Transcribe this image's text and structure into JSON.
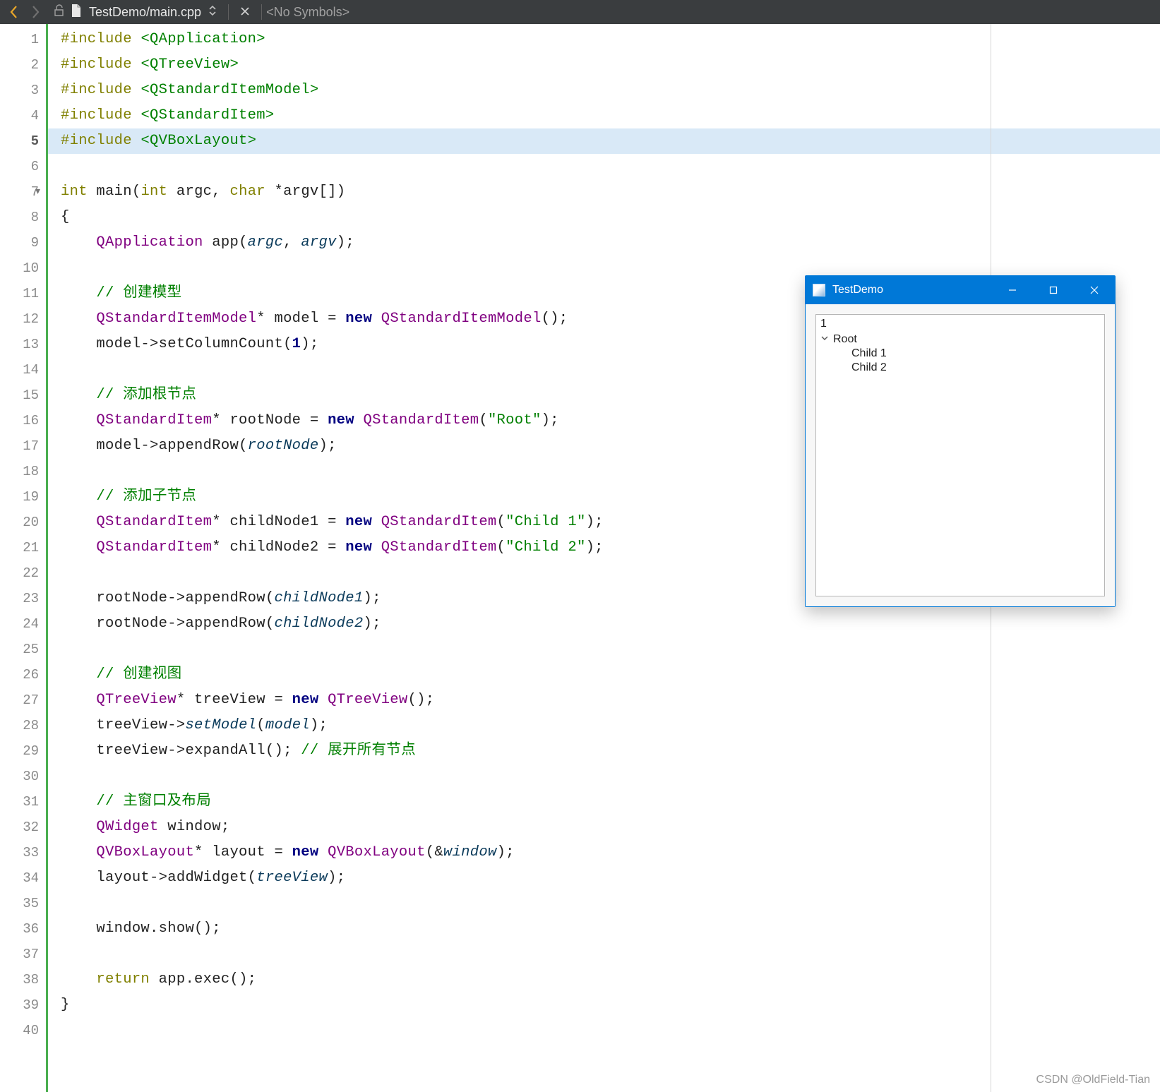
{
  "toolbar": {
    "filepath": "TestDemo/main.cpp",
    "symbols": "<No Symbols>"
  },
  "code": {
    "lines": [
      {
        "n": 1,
        "tokens": [
          {
            "c": "kw-olive",
            "t": "#include"
          },
          {
            "c": "dark",
            "t": " "
          },
          {
            "c": "incpath",
            "t": "<QApplication>"
          }
        ]
      },
      {
        "n": 2,
        "tokens": [
          {
            "c": "kw-olive",
            "t": "#include"
          },
          {
            "c": "dark",
            "t": " "
          },
          {
            "c": "incpath",
            "t": "<QTreeView>"
          }
        ]
      },
      {
        "n": 3,
        "tokens": [
          {
            "c": "kw-olive",
            "t": "#include"
          },
          {
            "c": "dark",
            "t": " "
          },
          {
            "c": "incpath",
            "t": "<QStandardItemModel>"
          }
        ]
      },
      {
        "n": 4,
        "tokens": [
          {
            "c": "kw-olive",
            "t": "#include"
          },
          {
            "c": "dark",
            "t": " "
          },
          {
            "c": "incpath",
            "t": "<QStandardItem>"
          }
        ]
      },
      {
        "n": 5,
        "hl": true,
        "tokens": [
          {
            "c": "kw-olive",
            "t": "#include"
          },
          {
            "c": "dark",
            "t": " "
          },
          {
            "c": "incpath",
            "t": "<QVBoxLayout>"
          }
        ]
      },
      {
        "n": 6,
        "tokens": []
      },
      {
        "n": 7,
        "fold": true,
        "tokens": [
          {
            "c": "kw-olive",
            "t": "int"
          },
          {
            "c": "dark",
            "t": " "
          },
          {
            "c": "fnname",
            "t": "main"
          },
          {
            "c": "dark",
            "t": "("
          },
          {
            "c": "kw-olive",
            "t": "int"
          },
          {
            "c": "dark",
            "t": " argc, "
          },
          {
            "c": "kw-olive",
            "t": "char"
          },
          {
            "c": "dark",
            "t": " *argv[])"
          }
        ]
      },
      {
        "n": 8,
        "tokens": [
          {
            "c": "dark",
            "t": "{"
          }
        ]
      },
      {
        "n": 9,
        "indent": 1,
        "tokens": [
          {
            "c": "kw-type",
            "t": "QApplication"
          },
          {
            "c": "dark",
            "t": " app("
          },
          {
            "c": "ital",
            "t": "argc"
          },
          {
            "c": "dark",
            "t": ", "
          },
          {
            "c": "ital",
            "t": "argv"
          },
          {
            "c": "dark",
            "t": ");"
          }
        ]
      },
      {
        "n": 10,
        "tokens": []
      },
      {
        "n": 11,
        "indent": 1,
        "tokens": [
          {
            "c": "cmnt",
            "t": "// 创建模型"
          }
        ]
      },
      {
        "n": 12,
        "indent": 1,
        "tokens": [
          {
            "c": "kw-type",
            "t": "QStandardItemModel"
          },
          {
            "c": "dark",
            "t": "* model = "
          },
          {
            "c": "kw-navy",
            "t": "new"
          },
          {
            "c": "dark",
            "t": " "
          },
          {
            "c": "kw-type",
            "t": "QStandardItemModel"
          },
          {
            "c": "dark",
            "t": "();"
          }
        ]
      },
      {
        "n": 13,
        "indent": 1,
        "tokens": [
          {
            "c": "dark",
            "t": "model->setColumnCount("
          },
          {
            "c": "kw-navy",
            "t": "1"
          },
          {
            "c": "dark",
            "t": ");"
          }
        ]
      },
      {
        "n": 14,
        "tokens": []
      },
      {
        "n": 15,
        "indent": 1,
        "tokens": [
          {
            "c": "cmnt",
            "t": "// 添加根节点"
          }
        ]
      },
      {
        "n": 16,
        "indent": 1,
        "tokens": [
          {
            "c": "kw-type",
            "t": "QStandardItem"
          },
          {
            "c": "dark",
            "t": "* rootNode = "
          },
          {
            "c": "kw-navy",
            "t": "new"
          },
          {
            "c": "dark",
            "t": " "
          },
          {
            "c": "kw-type",
            "t": "QStandardItem"
          },
          {
            "c": "dark",
            "t": "("
          },
          {
            "c": "str",
            "t": "\"Root\""
          },
          {
            "c": "dark",
            "t": ");"
          }
        ]
      },
      {
        "n": 17,
        "indent": 1,
        "tokens": [
          {
            "c": "dark",
            "t": "model->appendRow("
          },
          {
            "c": "ital",
            "t": "rootNode"
          },
          {
            "c": "dark",
            "t": ");"
          }
        ]
      },
      {
        "n": 18,
        "tokens": []
      },
      {
        "n": 19,
        "indent": 1,
        "tokens": [
          {
            "c": "cmnt",
            "t": "// 添加子节点"
          }
        ]
      },
      {
        "n": 20,
        "indent": 1,
        "tokens": [
          {
            "c": "kw-type",
            "t": "QStandardItem"
          },
          {
            "c": "dark",
            "t": "* childNode1 = "
          },
          {
            "c": "kw-navy",
            "t": "new"
          },
          {
            "c": "dark",
            "t": " "
          },
          {
            "c": "kw-type",
            "t": "QStandardItem"
          },
          {
            "c": "dark",
            "t": "("
          },
          {
            "c": "str",
            "t": "\"Child 1\""
          },
          {
            "c": "dark",
            "t": ");"
          }
        ]
      },
      {
        "n": 21,
        "indent": 1,
        "tokens": [
          {
            "c": "kw-type",
            "t": "QStandardItem"
          },
          {
            "c": "dark",
            "t": "* childNode2 = "
          },
          {
            "c": "kw-navy",
            "t": "new"
          },
          {
            "c": "dark",
            "t": " "
          },
          {
            "c": "kw-type",
            "t": "QStandardItem"
          },
          {
            "c": "dark",
            "t": "("
          },
          {
            "c": "str",
            "t": "\"Child 2\""
          },
          {
            "c": "dark",
            "t": ");"
          }
        ]
      },
      {
        "n": 22,
        "tokens": []
      },
      {
        "n": 23,
        "indent": 1,
        "tokens": [
          {
            "c": "dark",
            "t": "rootNode->appendRow("
          },
          {
            "c": "ital",
            "t": "childNode1"
          },
          {
            "c": "dark",
            "t": ");"
          }
        ]
      },
      {
        "n": 24,
        "indent": 1,
        "tokens": [
          {
            "c": "dark",
            "t": "rootNode->appendRow("
          },
          {
            "c": "ital",
            "t": "childNode2"
          },
          {
            "c": "dark",
            "t": ");"
          }
        ]
      },
      {
        "n": 25,
        "tokens": []
      },
      {
        "n": 26,
        "indent": 1,
        "tokens": [
          {
            "c": "cmnt",
            "t": "// 创建视图"
          }
        ]
      },
      {
        "n": 27,
        "indent": 1,
        "tokens": [
          {
            "c": "kw-type",
            "t": "QTreeView"
          },
          {
            "c": "dark",
            "t": "* treeView = "
          },
          {
            "c": "kw-navy",
            "t": "new"
          },
          {
            "c": "dark",
            "t": " "
          },
          {
            "c": "kw-type",
            "t": "QTreeView"
          },
          {
            "c": "dark",
            "t": "();"
          }
        ]
      },
      {
        "n": 28,
        "indent": 1,
        "tokens": [
          {
            "c": "dark",
            "t": "treeView->"
          },
          {
            "c": "ital",
            "t": "setModel"
          },
          {
            "c": "dark",
            "t": "("
          },
          {
            "c": "ital",
            "t": "model"
          },
          {
            "c": "dark",
            "t": ");"
          }
        ]
      },
      {
        "n": 29,
        "indent": 1,
        "tokens": [
          {
            "c": "dark",
            "t": "treeView->expandAll(); "
          },
          {
            "c": "cmnt",
            "t": "// 展开所有节点"
          }
        ]
      },
      {
        "n": 30,
        "tokens": []
      },
      {
        "n": 31,
        "indent": 1,
        "tokens": [
          {
            "c": "cmnt",
            "t": "// 主窗口及布局"
          }
        ]
      },
      {
        "n": 32,
        "indent": 1,
        "tokens": [
          {
            "c": "kw-type",
            "t": "QWidget"
          },
          {
            "c": "dark",
            "t": " window;"
          }
        ]
      },
      {
        "n": 33,
        "indent": 1,
        "tokens": [
          {
            "c": "kw-type",
            "t": "QVBoxLayout"
          },
          {
            "c": "dark",
            "t": "* layout = "
          },
          {
            "c": "kw-navy",
            "t": "new"
          },
          {
            "c": "dark",
            "t": " "
          },
          {
            "c": "kw-type",
            "t": "QVBoxLayout"
          },
          {
            "c": "dark",
            "t": "(&"
          },
          {
            "c": "ital",
            "t": "window"
          },
          {
            "c": "dark",
            "t": ");"
          }
        ]
      },
      {
        "n": 34,
        "indent": 1,
        "tokens": [
          {
            "c": "dark",
            "t": "layout->addWidget("
          },
          {
            "c": "ital",
            "t": "treeView"
          },
          {
            "c": "dark",
            "t": ");"
          }
        ]
      },
      {
        "n": 35,
        "tokens": []
      },
      {
        "n": 36,
        "indent": 1,
        "tokens": [
          {
            "c": "dark",
            "t": "window.show();"
          }
        ]
      },
      {
        "n": 37,
        "tokens": []
      },
      {
        "n": 38,
        "indent": 1,
        "tokens": [
          {
            "c": "kw-olive",
            "t": "return"
          },
          {
            "c": "dark",
            "t": " app.exec();"
          }
        ]
      },
      {
        "n": 39,
        "tokens": [
          {
            "c": "dark",
            "t": "}"
          }
        ]
      },
      {
        "n": 40,
        "tokens": []
      }
    ],
    "current_line": 5
  },
  "app": {
    "title": "TestDemo",
    "header": "1",
    "tree": [
      {
        "level": 1,
        "expanded": true,
        "label": "Root"
      },
      {
        "level": 2,
        "label": "Child 1"
      },
      {
        "level": 2,
        "label": "Child 2"
      }
    ]
  },
  "watermark": "CSDN @OldField-Tian"
}
